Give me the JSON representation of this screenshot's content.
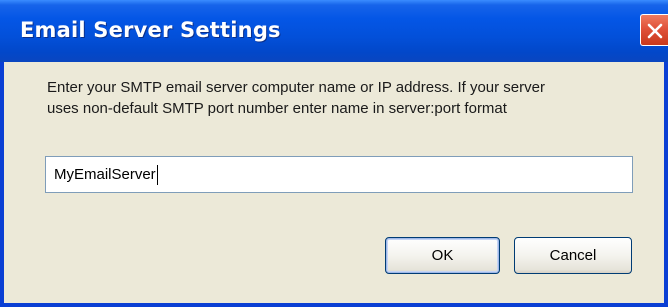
{
  "dialog": {
    "title": "Email Server Settings",
    "close_icon": "close-icon",
    "message_line1": "Enter your SMTP email server computer name or IP address. If your server",
    "message_line2": "uses non-default SMTP port number enter name in server:port format",
    "server_value": "MyEmailServer",
    "ok_label": "OK",
    "cancel_label": "Cancel"
  },
  "colors": {
    "titlebar": "#0456e6",
    "window_frame": "#0a3fd4",
    "client_background": "#ece9d8",
    "close_button": "#e0523a"
  }
}
